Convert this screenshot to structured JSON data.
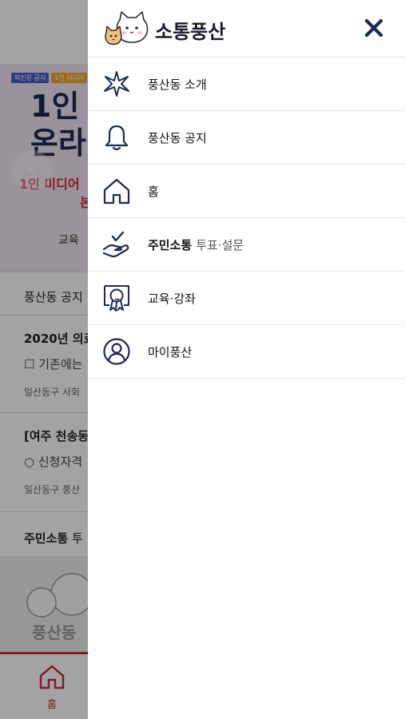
{
  "background": {
    "banner": {
      "tags": [
        "외신문 공지",
        "1인 미디어"
      ],
      "title_lines": [
        "1인",
        "온라"
      ],
      "subtitle": "1인 미디어 ",
      "subtitle2": "본",
      "caption": "교육",
      "prev_arrow": "‹"
    },
    "notice_header": "풍산동 공지",
    "notices": [
      {
        "title": "2020년 의료",
        "body": "☐ 기존에는",
        "meta": "일산동구 사회"
      },
      {
        "title": "[여주 천송동",
        "body": "○ 신청자격",
        "meta": "일산동구 풍산"
      }
    ],
    "survey_header_bold": "주민소통",
    "survey_header_rest": "투",
    "survey_caption": "풍산동",
    "bottom_nav": {
      "home_label": "홈"
    }
  },
  "drawer": {
    "title": "소통풍산",
    "close_label": "×",
    "menu": [
      {
        "icon": "star-leaf-icon",
        "label": "풍산동 소개"
      },
      {
        "icon": "bell-icon",
        "label": "풍산동 공지"
      },
      {
        "icon": "home-icon",
        "label": "홈"
      },
      {
        "icon": "hand-check-icon",
        "label": "주민소통",
        "sub": "투표·설문"
      },
      {
        "icon": "award-ribbon-icon",
        "label": "교육·강좌"
      },
      {
        "icon": "user-circle-icon",
        "label": "마이풍산"
      }
    ]
  },
  "colors": {
    "accent": "#1d2a52",
    "brand_red": "#c8283c",
    "overlay": "rgba(0,0,0,0.36)"
  }
}
